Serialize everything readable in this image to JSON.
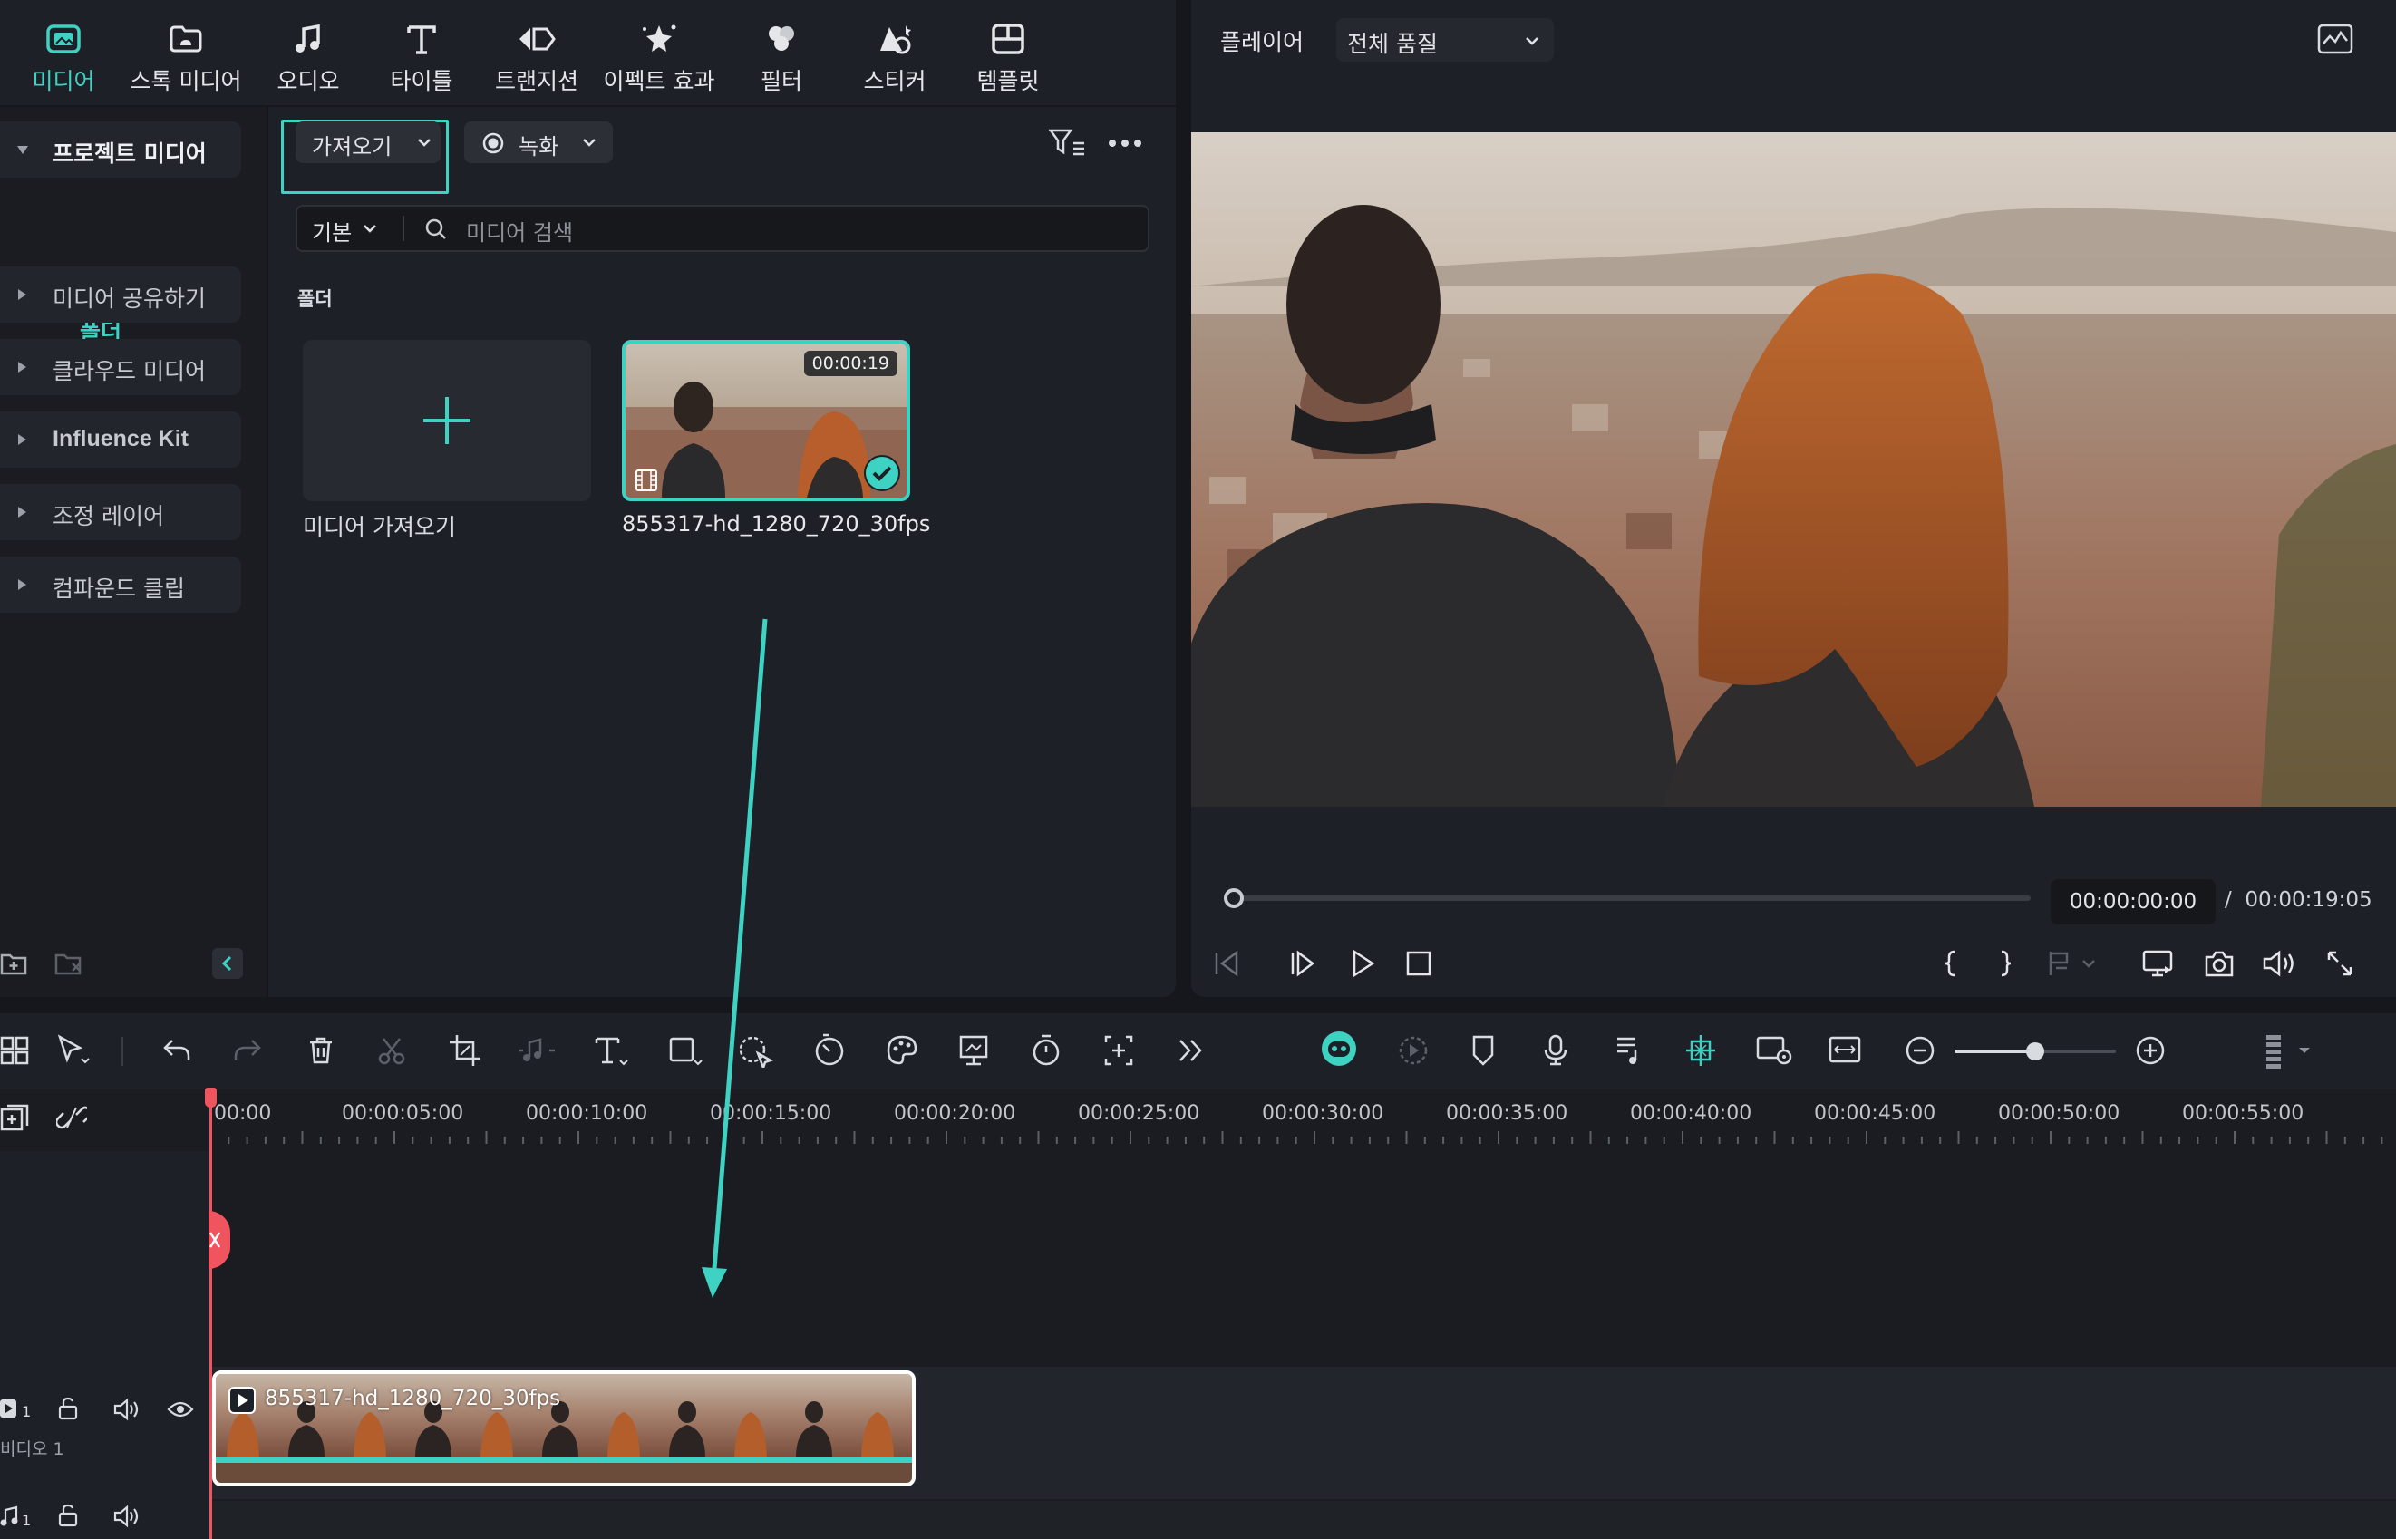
{
  "nav": {
    "tabs": [
      {
        "label": "미디어",
        "icon": "media-icon",
        "active": true
      },
      {
        "label": "스톡 미디어",
        "icon": "stock-media-icon"
      },
      {
        "label": "오디오",
        "icon": "music-note-icon"
      },
      {
        "label": "타이틀",
        "icon": "title-text-icon"
      },
      {
        "label": "트랜지션",
        "icon": "transition-icon"
      },
      {
        "label": "이펙트 효과",
        "icon": "effects-icon"
      },
      {
        "label": "필터",
        "icon": "filter-icon"
      },
      {
        "label": "스티커",
        "icon": "sticker-icon"
      },
      {
        "label": "템플릿",
        "icon": "template-icon"
      }
    ]
  },
  "sidebar": {
    "project_media": "프로젝트 미디어",
    "folder": "폴더",
    "items": [
      {
        "label": "미디어 공유하기"
      },
      {
        "label": "클라우드 미디어"
      },
      {
        "label": "Influence Kit"
      },
      {
        "label": "조정 레이어"
      },
      {
        "label": "컴파운드 클립"
      }
    ]
  },
  "media": {
    "import_button": "가져오기",
    "record_button": "녹화",
    "sort_label": "기본",
    "search_placeholder": "미디어 검색",
    "folder_title": "폴더",
    "import_card_label": "미디어 가져오기",
    "clip": {
      "name": "855317-hd_1280_720_30fps",
      "duration": "00:00:19"
    }
  },
  "player": {
    "title": "플레이어",
    "quality": "전체 품질",
    "current_time": "00:00:00:00",
    "separator": "/",
    "total_time": "00:00:19:05",
    "progress": 0
  },
  "timeline": {
    "ruler": [
      "00:00",
      "00:00:05:00",
      "00:00:10:00",
      "00:00:15:00",
      "00:00:20:00",
      "00:00:25:00",
      "00:00:30:00",
      "00:00:35:00",
      "00:00:40:00",
      "00:00:45:00",
      "00:00:50:00",
      "00:00:55:00"
    ],
    "video_track": {
      "number": "1",
      "label": "비디오 1"
    },
    "audio_track": {
      "number": "1"
    },
    "clip_name": "855317-hd_1280_720_30fps",
    "zoom_level": 0.5
  },
  "colors": {
    "accent": "#3ed2c2",
    "playhead": "#f0545e",
    "panel": "#1d2026"
  }
}
